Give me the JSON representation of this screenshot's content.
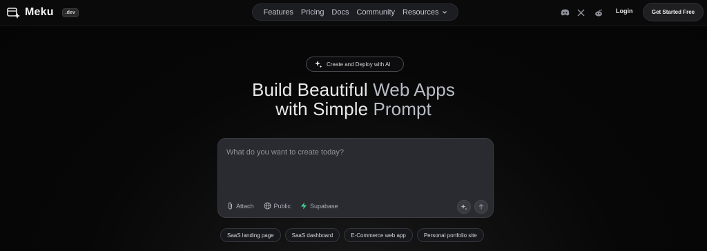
{
  "brand": {
    "name": "Meku",
    "badge": ".dev"
  },
  "nav": {
    "items": [
      {
        "label": "Features"
      },
      {
        "label": "Pricing"
      },
      {
        "label": "Docs"
      },
      {
        "label": "Community"
      },
      {
        "label": "Resources"
      }
    ]
  },
  "header_actions": {
    "social_icons": [
      "discord-icon",
      "x-icon",
      "reddit-icon"
    ],
    "login_label": "Login",
    "cta_label": "Get Started Free"
  },
  "hero": {
    "pill_label": "Create and Deploy with AI",
    "headline_line1_a": "Build Beautiful ",
    "headline_line1_b": "Web Apps",
    "headline_line2_a": "with Simple ",
    "headline_line2_b": "Prompt"
  },
  "prompt": {
    "placeholder": "What do you want to create today?",
    "value": "",
    "tools": [
      {
        "label": "Attach",
        "icon": "paperclip-icon"
      },
      {
        "label": "Public",
        "icon": "globe-icon"
      },
      {
        "label": "Supabase",
        "icon": "supabase-icon"
      }
    ]
  },
  "suggestions": [
    {
      "label": "SaaS landing page"
    },
    {
      "label": "SaaS dashboard"
    },
    {
      "label": "E-Commerce web app"
    },
    {
      "label": "Personal portfolio site"
    }
  ],
  "colors": {
    "background": "#050505",
    "supabase_accent": "#3ecf8e",
    "panel": "#2a2b30"
  }
}
